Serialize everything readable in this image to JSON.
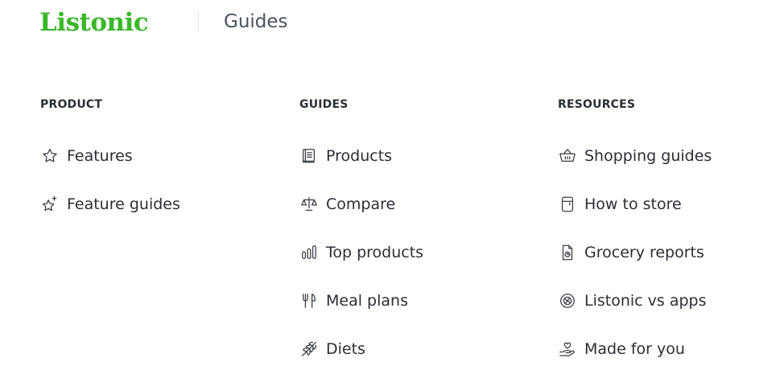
{
  "header": {
    "logo_text": "Listonic",
    "section_title": "Guides"
  },
  "columns": [
    {
      "heading": "PRODUCT",
      "items": [
        {
          "label": "Features",
          "icon": "star-icon"
        },
        {
          "label": "Feature guides",
          "icon": "sparkle-star-icon"
        }
      ]
    },
    {
      "heading": "GUIDES",
      "items": [
        {
          "label": "Products",
          "icon": "book-icon"
        },
        {
          "label": "Compare",
          "icon": "scales-icon"
        },
        {
          "label": "Top products",
          "icon": "bar-chart-icon"
        },
        {
          "label": "Meal plans",
          "icon": "fork-knife-icon"
        },
        {
          "label": "Diets",
          "icon": "wheat-icon"
        }
      ]
    },
    {
      "heading": "RESOURCES",
      "items": [
        {
          "label": "Shopping guides",
          "icon": "basket-icon"
        },
        {
          "label": "How to store",
          "icon": "fridge-icon"
        },
        {
          "label": "Grocery reports",
          "icon": "report-icon"
        },
        {
          "label": "Listonic vs apps",
          "icon": "versus-icon"
        },
        {
          "label": "Made for you",
          "icon": "heart-hand-icon"
        }
      ]
    }
  ],
  "colors": {
    "brand": "#3bb72b",
    "text": "#2b2f36",
    "muted": "#4a5260"
  }
}
